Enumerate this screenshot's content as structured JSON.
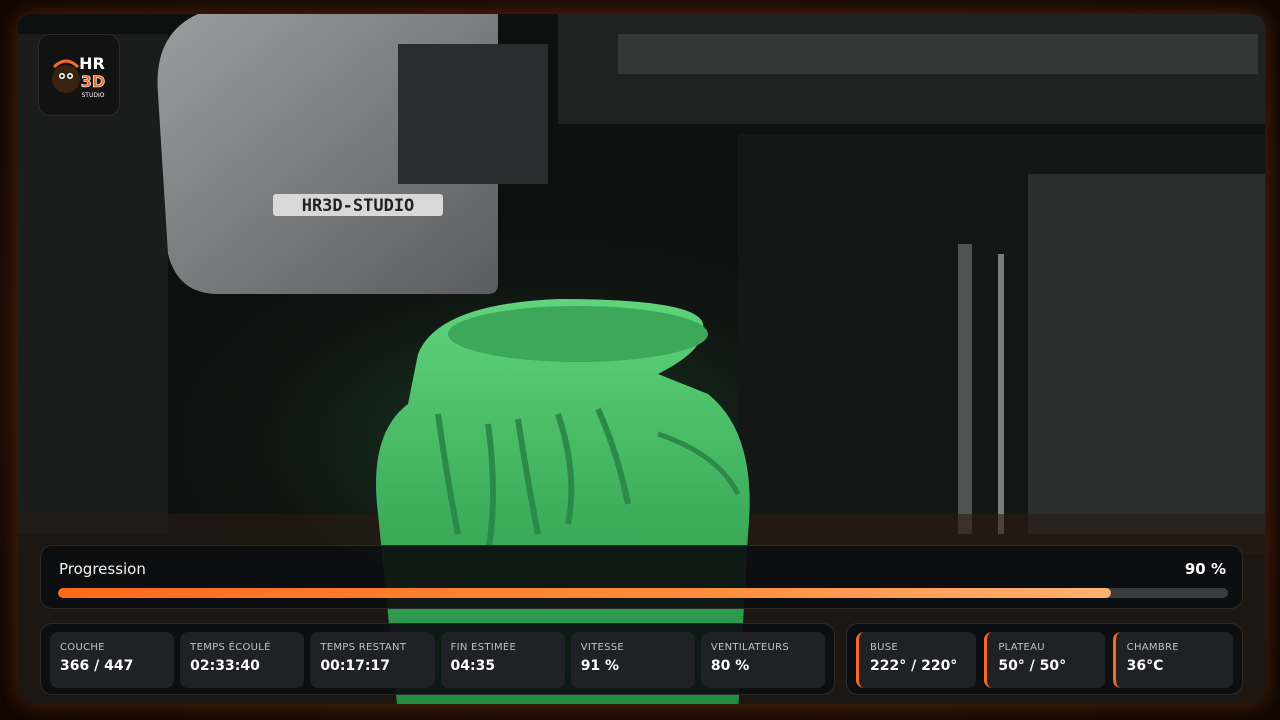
{
  "camera": {
    "printer_label": "HR3D-STUDIO"
  },
  "logo": {
    "line1": "HR",
    "line2": "3D",
    "line3": "STUDIO"
  },
  "progress": {
    "label": "Progression",
    "value_text": "90 %",
    "fraction": 0.9
  },
  "stats": [
    {
      "label": "COUCHE",
      "value": "366 / 447"
    },
    {
      "label": "TEMPS ÉCOULÉ",
      "value": "02:33:40"
    },
    {
      "label": "TEMPS RESTANT",
      "value": "00:17:17"
    },
    {
      "label": "FIN ESTIMÉE",
      "value": "04:35"
    },
    {
      "label": "VITESSE",
      "value": "91 %"
    },
    {
      "label": "VENTILATEURS",
      "value": "80 %"
    }
  ],
  "temps": [
    {
      "label": "BUSE",
      "value": "222° / 220°"
    },
    {
      "label": "PLATEAU",
      "value": "50° / 50°"
    },
    {
      "label": "CHAMBRE",
      "value": "36°C"
    }
  ],
  "colors": {
    "accent": "#ff6a1a",
    "panel": "#0c0e10",
    "tile": "#1f2124",
    "filament": "#3fb85f"
  }
}
